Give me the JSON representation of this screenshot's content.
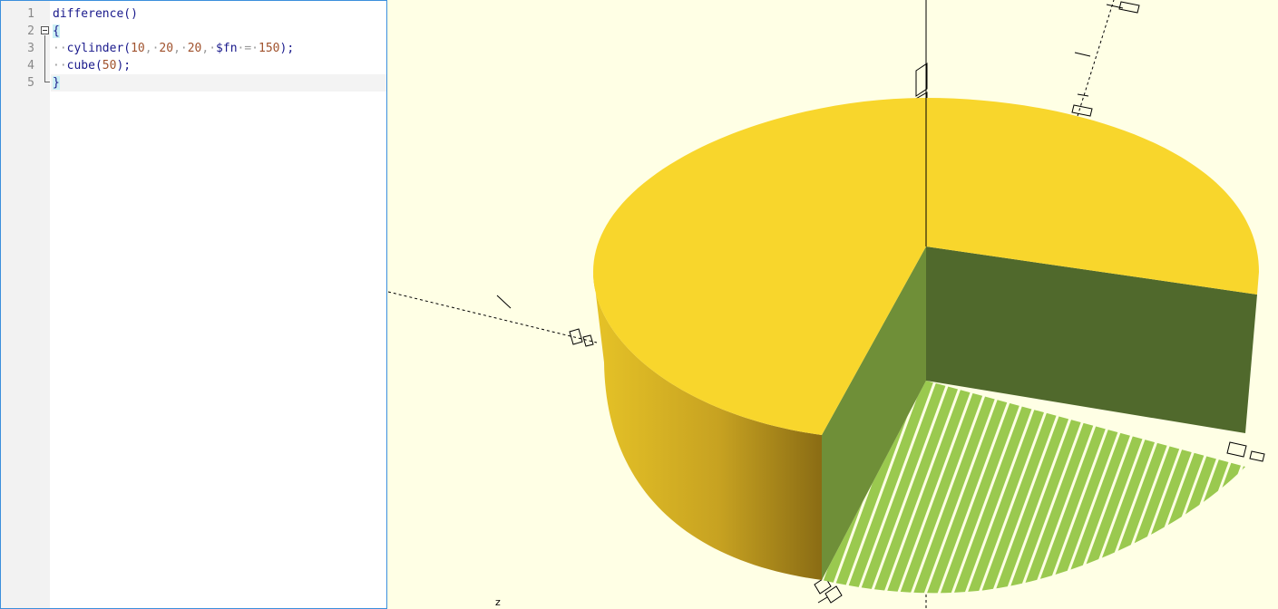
{
  "editor": {
    "line_numbers": [
      "1",
      "2",
      "3",
      "4",
      "5"
    ],
    "lines": {
      "l1": "difference()",
      "l2_brace": "{",
      "l3_indent": "··",
      "l3_fn": "cylinder(",
      "l3_a": "10",
      "l3_s1": ",·",
      "l3_b": "20",
      "l3_s2": ",·",
      "l3_c": "20",
      "l3_s3": ",·",
      "l3_fnvar": "$fn",
      "l3_eq": "·=·",
      "l3_d": "150",
      "l3_end": ");",
      "l4_indent": "··",
      "l4_fn": "cube(",
      "l4_a": "50",
      "l4_end": ");",
      "l5_brace": "}"
    }
  },
  "viewport": {
    "axis_label_z": "z",
    "colors": {
      "background": "#ffffe5",
      "top_face": "#f8d62c",
      "side_face": "#c9a922",
      "cut_face_left": "#6f8f38",
      "cut_face_right": "#50692c",
      "cut_bottom": "#9ac94f"
    }
  }
}
